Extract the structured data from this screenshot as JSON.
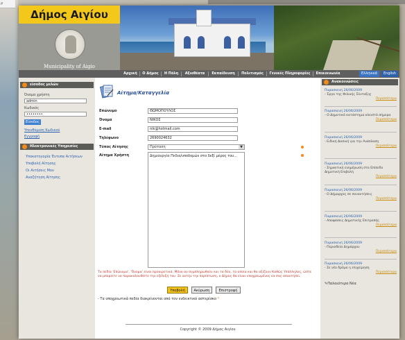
{
  "background": {
    "left_tab_text": "ρ"
  },
  "header": {
    "site_title": "Δήμος Αιγίου",
    "subtitle": "Municipality of Aigio"
  },
  "nav": {
    "items": [
      "Αρχική",
      "Ο Δήμος",
      "Η Πόλη",
      "Αξιοθέατα",
      "Εκπαίδευση",
      "Πολιτισμός",
      "Γενικές Πληροφορίες",
      "Επικοινωνία"
    ],
    "languages": [
      "Ελληνικά",
      "English"
    ]
  },
  "login": {
    "heading": "είσοδος μελών",
    "username_label": "Όνομα χρήστη",
    "username_value": "admin",
    "password_label": "Κωδικός",
    "password_value": "••••••••",
    "login_button": "Είσοδος",
    "forgot_link": "Υπενθύμιση Κωδικού",
    "register_link": "Εγγραφή"
  },
  "services": {
    "heading": "Ηλεκτρονικές Υπηρεσίες",
    "items": [
      "Υποκατηγορία Έντυπα Αιτήσεων",
      "Υποβολή Αίτησης",
      "Οι Αιτήσεις Μου",
      "Αναζήτηση Αίτησης"
    ]
  },
  "form": {
    "title": "Αίτημα/Καταγγελία",
    "labels": {
      "surname": "Επώνυμο",
      "name": "Όνομα",
      "email": "E-mail",
      "phone": "Τηλέφωνο",
      "type": "Τύπος Αίτησης",
      "request": "Αίτημα Χρήστη"
    },
    "values": {
      "surname": "ΘΩΜΟΠΟΥΛΟΣ",
      "name": "ΝΙΚΟΣ",
      "email": "nik@hotmail.com",
      "phone": "2690024632",
      "type": "Πρόταση",
      "request": "Δημιουργία Πεδιο/υποδομών στο δεξί μέρος του..."
    },
    "notice": "Τα πεδία 'Επώνυμο', 'Όνομα' είναι προαιρετικά. Μόνο αν συμπληρωθούν και τα δύο, τα οποία και θα αξίζουν Καθώς Υπάλληλος, ώστε να μπορείτε να παρακολουθείτε την εξέλιξή του. Σε αυτήν την περίπτωση, ο Δήμος θα είναι υποχρεωμένος να σας απαντήσει.",
    "buttons": {
      "submit": "Υποβολή",
      "cancel": "Ακύρωση",
      "back": "Επιστροφή"
    },
    "required_note": "- Τα υποχρεωτικά πεδία διακρίνονται από τον ενδεικτικό αστερίσκο",
    "required_mark": "*"
  },
  "footer": {
    "copyright": "Copyright © 2009 Δήμος Αιγίου"
  },
  "news": {
    "heading": "Ανακοινώσεις",
    "more_label": "Περισσότερα",
    "older_link": "Παλαιότερα Νέα",
    "items": [
      {
        "date": "Παρασκευή 26/06/2009",
        "text": "- Έργο της Φιλικής Σύνταξης"
      },
      {
        "date": "Παρασκευή 26/06/2009",
        "text": "- Ο Δημοτικό κατάστημα κλειστό σήμερα"
      },
      {
        "date": "Παρασκευή 26/06/2009",
        "text": "- Ειδική Δασική για την Ανάπλαση"
      },
      {
        "date": "Παρασκευή 26/06/2009",
        "text": "- Σημαντική ενημέρωση στο Επίπεδο Δημοτική Επιβολή"
      },
      {
        "date": "Παρασκευή 26/06/2009",
        "text": "- Ο Δήμαρχος σε συναντήσεις"
      },
      {
        "date": "Παρασκευή 26/06/2009",
        "text": "- Αποφάσεις Δημοτικής Επιτροπής"
      },
      {
        "date": "Παρασκευή 26/06/2009",
        "text": "- Περιοδεία Δημάρχου"
      },
      {
        "date": "Παρασκευή 26/06/2009",
        "text": "- Σε νέο δρόμο η επιχείρηση"
      }
    ]
  }
}
